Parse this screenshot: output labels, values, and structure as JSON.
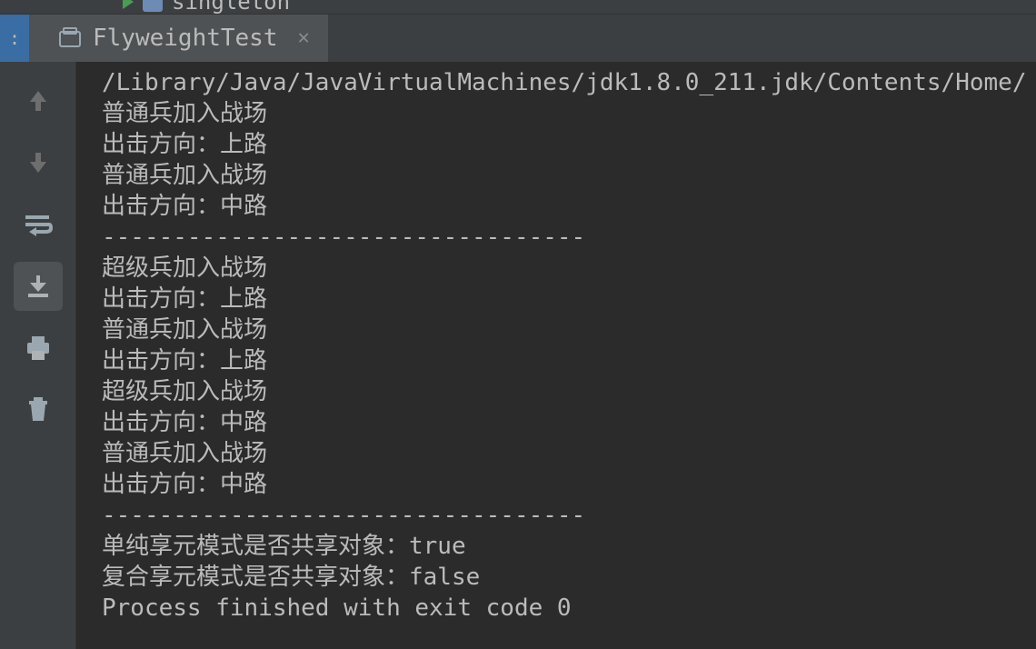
{
  "topbar": {
    "module_label": "singleton"
  },
  "run": {
    "label": ":",
    "tab_name": "FlyweightTest"
  },
  "console": {
    "lines": [
      "/Library/Java/JavaVirtualMachines/jdk1.8.0_211.jdk/Contents/Home/",
      "普通兵加入战场",
      "出击方向：上路",
      "普通兵加入战场",
      "出击方向：中路",
      "----------------------------------",
      "超级兵加入战场",
      "出击方向：上路",
      "普通兵加入战场",
      "出击方向：上路",
      "超级兵加入战场",
      "出击方向：中路",
      "普通兵加入战场",
      "出击方向：中路",
      "----------------------------------",
      "单纯享元模式是否共享对象：true",
      "复合享元模式是否共享对象：false",
      "",
      "Process finished with exit code 0"
    ]
  }
}
